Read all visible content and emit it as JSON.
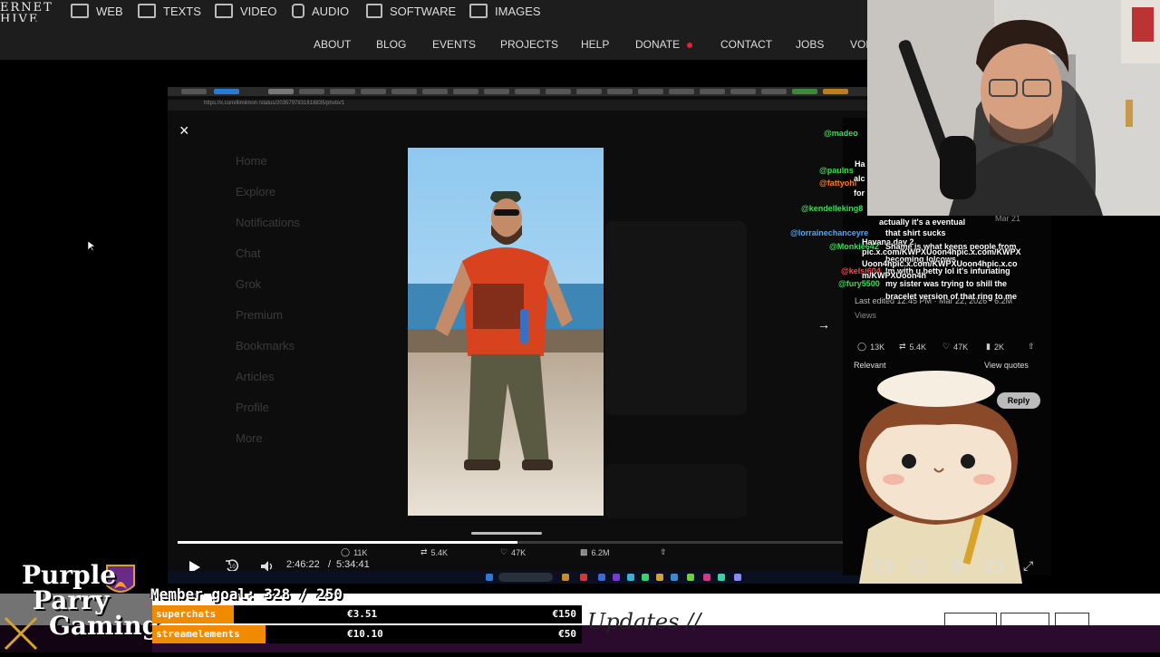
{
  "site": {
    "logo_lines": [
      "ERNET",
      "HIVE"
    ],
    "categories": [
      {
        "label": "WEB",
        "icon": "web-icon"
      },
      {
        "label": "TEXTS",
        "icon": "book-icon"
      },
      {
        "label": "VIDEO",
        "icon": "film-icon"
      },
      {
        "label": "AUDIO",
        "icon": "speaker-icon"
      },
      {
        "label": "SOFTWARE",
        "icon": "floppy-icon"
      },
      {
        "label": "IMAGES",
        "icon": "image-icon"
      }
    ],
    "subnav": [
      "ABOUT",
      "BLOG",
      "EVENTS",
      "PROJECTS",
      "HELP",
      "DONATE",
      "CONTACT",
      "JOBS",
      "VOL"
    ]
  },
  "browser": {
    "url": "https://x.com/ilimiimon /status/2035797831818835/photo/1",
    "tweet_menu": [
      "Home",
      "Explore",
      "Notifications",
      "Chat",
      "Grok",
      "Premium",
      "Bookmarks",
      "Articles",
      "Profile",
      "More"
    ]
  },
  "player": {
    "close_glyph": "×",
    "next_glyph": "→",
    "time_current": "2:46:22",
    "time_separator": "/",
    "time_total": "5:34:41",
    "progress": 0.497,
    "replies": "11K",
    "reposts": "5.4K",
    "likes": "47K",
    "views": "6.2M",
    "skip_label": "10"
  },
  "tweet_panel": {
    "meta": "Last edited 12:45 PM · Mar 22, 2026 · 6.2M",
    "views_label": "Views",
    "replies": "13K",
    "reposts": "5.4K",
    "likes": "47K",
    "bookmarks": "2K",
    "sort": "Relevant",
    "view_quotes": "View quotes",
    "reply_button": "Reply",
    "date_fragment": "Mar 21"
  },
  "chat": [
    {
      "user": "@madeo",
      "color": "#3ddc55",
      "msg": ""
    },
    {
      "user": "@paulns",
      "color": "#3ddc55",
      "msg": "Ha"
    },
    {
      "user": "@fattyohi",
      "color": "#ff7a2a",
      "msg": "alc"
    },
    {
      "user": "",
      "color": "#ffffff",
      "msg": "for"
    },
    {
      "user": "@kendelleking8",
      "color": "#3ddc55",
      "msg": ""
    },
    {
      "user": "",
      "color": "#ffffff",
      "msg": "actually it's a eventual"
    },
    {
      "user": "",
      "color": "#ffffff",
      "msg": "that shirt sucks"
    },
    {
      "user": "@lorrainechanceyre",
      "color": "#4aa8ff",
      "msg": "Havana day 2"
    },
    {
      "user": "@Monkie642",
      "color": "#3ddc55",
      "msg": "Shame is what keeps people from"
    },
    {
      "user": "",
      "color": "#ffffff",
      "msg": "pic.x.com/KWPXUoon4hpic.x.com/KWPX"
    },
    {
      "user": "",
      "color": "#ffffff",
      "msg": "becoming lolcows"
    },
    {
      "user": "",
      "color": "#ffffff",
      "msg": "Uoon4hpic.x.com/KWPXUoon4hpic.x.co"
    },
    {
      "user": "@kelsi604",
      "color": "#ff4a4a",
      "msg": "Im with u betty lol it's infuriating"
    },
    {
      "user": "",
      "color": "#ffffff",
      "msg": "m/KWPXUoon4h"
    },
    {
      "user": "@fury5500",
      "color": "#3ddc55",
      "msg": "my sister was trying to shill the"
    },
    {
      "user": "",
      "color": "#ffffff",
      "msg": "bracelet version of that ring to me"
    }
  ],
  "overlay": {
    "logo_lines": [
      "Purple",
      "Parry",
      "Gaming"
    ],
    "member_goal": "Member goal: 328 / 250",
    "goals": [
      {
        "label": "superchats",
        "current": "€3.51",
        "target": "€150",
        "color": "#f08a00",
        "fraction": 0.023
      },
      {
        "label": "streamelements",
        "current": "€10.10",
        "target": "€50",
        "color": "#f08a00",
        "fraction": 0.202
      }
    ],
    "updates_text": "Updates //"
  }
}
